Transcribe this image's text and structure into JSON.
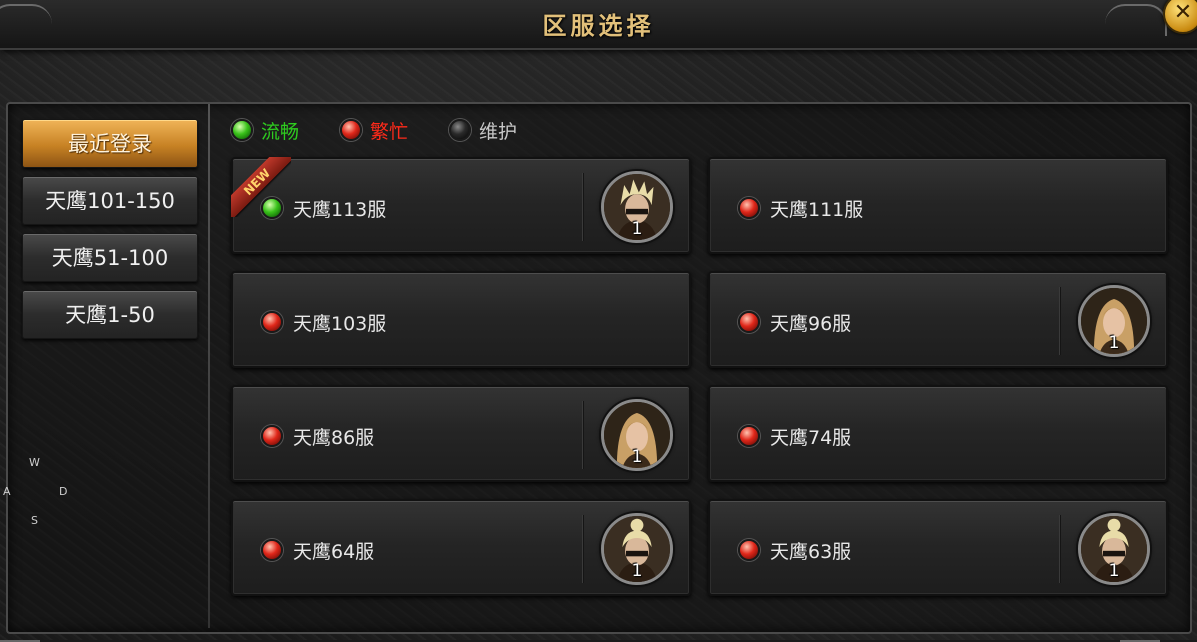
{
  "window": {
    "title": "区服选择",
    "close_label": "✕"
  },
  "tabs": [
    {
      "label": "最近登录",
      "active": true
    },
    {
      "label": "天鹰101-150",
      "active": false
    },
    {
      "label": "天鹰51-100",
      "active": false
    },
    {
      "label": "天鹰1-50",
      "active": false
    }
  ],
  "legend": [
    {
      "label": "流畅",
      "status": "green",
      "color": "#2ecc1f"
    },
    {
      "label": "繁忙",
      "status": "red",
      "color": "#ff2a1a"
    },
    {
      "label": "维护",
      "status": "black",
      "color": "#c8c8c8"
    }
  ],
  "new_badge": "NEW",
  "servers": [
    {
      "name": "天鹰113服",
      "status": "green",
      "is_new": true,
      "avatar": "blonde-spiky-hair",
      "level": "1"
    },
    {
      "name": "天鹰111服",
      "status": "red",
      "is_new": false,
      "avatar": null,
      "level": null
    },
    {
      "name": "天鹰103服",
      "status": "red",
      "is_new": false,
      "avatar": null,
      "level": null
    },
    {
      "name": "天鹰96服",
      "status": "red",
      "is_new": false,
      "avatar": "long-hair-female",
      "level": "1"
    },
    {
      "name": "天鹰86服",
      "status": "red",
      "is_new": false,
      "avatar": "long-hair-female",
      "level": "1"
    },
    {
      "name": "天鹰74服",
      "status": "red",
      "is_new": false,
      "avatar": null,
      "level": null
    },
    {
      "name": "天鹰64服",
      "status": "red",
      "is_new": false,
      "avatar": "blonde-topknot",
      "level": "1"
    },
    {
      "name": "天鹰63服",
      "status": "red",
      "is_new": false,
      "avatar": "blonde-topknot",
      "level": "1"
    }
  ],
  "wasd": {
    "w": "W",
    "a": "A",
    "s": "S",
    "d": "D"
  }
}
